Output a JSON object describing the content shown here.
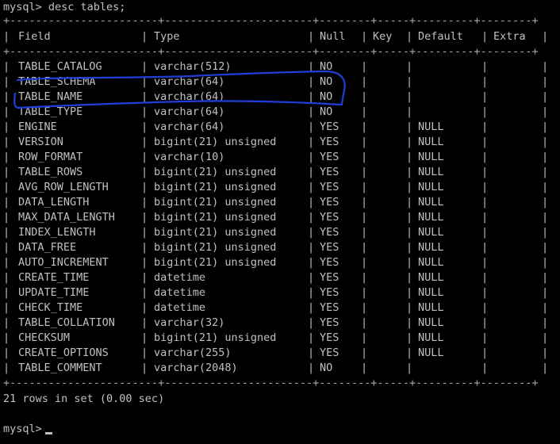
{
  "console": {
    "command_line": "mysql> desc tables;",
    "summary_line": "21 rows in set (0.00 sec)",
    "prompt": "mysql>"
  },
  "table": {
    "columns": [
      "Field",
      "Type",
      "Null",
      "Key",
      "Default",
      "Extra"
    ],
    "rows": [
      [
        "TABLE_CATALOG",
        "varchar(512)",
        "NO",
        "",
        "",
        ""
      ],
      [
        "TABLE_SCHEMA",
        "varchar(64)",
        "NO",
        "",
        "",
        ""
      ],
      [
        "TABLE_NAME",
        "varchar(64)",
        "NO",
        "",
        "",
        ""
      ],
      [
        "TABLE_TYPE",
        "varchar(64)",
        "NO",
        "",
        "",
        ""
      ],
      [
        "ENGINE",
        "varchar(64)",
        "YES",
        "",
        "NULL",
        ""
      ],
      [
        "VERSION",
        "bigint(21) unsigned",
        "YES",
        "",
        "NULL",
        ""
      ],
      [
        "ROW_FORMAT",
        "varchar(10)",
        "YES",
        "",
        "NULL",
        ""
      ],
      [
        "TABLE_ROWS",
        "bigint(21) unsigned",
        "YES",
        "",
        "NULL",
        ""
      ],
      [
        "AVG_ROW_LENGTH",
        "bigint(21) unsigned",
        "YES",
        "",
        "NULL",
        ""
      ],
      [
        "DATA_LENGTH",
        "bigint(21) unsigned",
        "YES",
        "",
        "NULL",
        ""
      ],
      [
        "MAX_DATA_LENGTH",
        "bigint(21) unsigned",
        "YES",
        "",
        "NULL",
        ""
      ],
      [
        "INDEX_LENGTH",
        "bigint(21) unsigned",
        "YES",
        "",
        "NULL",
        ""
      ],
      [
        "DATA_FREE",
        "bigint(21) unsigned",
        "YES",
        "",
        "NULL",
        ""
      ],
      [
        "AUTO_INCREMENT",
        "bigint(21) unsigned",
        "YES",
        "",
        "NULL",
        ""
      ],
      [
        "CREATE_TIME",
        "datetime",
        "YES",
        "",
        "NULL",
        ""
      ],
      [
        "UPDATE_TIME",
        "datetime",
        "YES",
        "",
        "NULL",
        ""
      ],
      [
        "CHECK_TIME",
        "datetime",
        "YES",
        "",
        "NULL",
        ""
      ],
      [
        "TABLE_COLLATION",
        "varchar(32)",
        "YES",
        "",
        "NULL",
        ""
      ],
      [
        "CHECKSUM",
        "bigint(21) unsigned",
        "YES",
        "",
        "NULL",
        ""
      ],
      [
        "CREATE_OPTIONS",
        "varchar(255)",
        "YES",
        "",
        "NULL",
        ""
      ],
      [
        "TABLE_COMMENT",
        "varchar(2048)",
        "NO",
        "",
        "",
        ""
      ]
    ]
  },
  "colors": {
    "background": "#000000",
    "text": "#c0c0c0",
    "annotation_ink": "#1f3fd8"
  },
  "annotation": {
    "shape": "hand-drawn-loop",
    "highlighted_fields": [
      "TABLE_SCHEMA",
      "TABLE_NAME"
    ]
  }
}
